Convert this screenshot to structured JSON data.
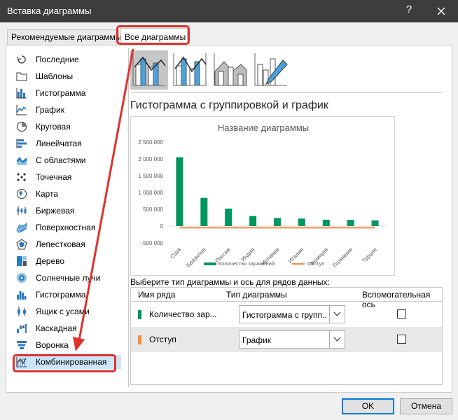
{
  "window": {
    "title": "Вставка диаграммы",
    "help_label": "?"
  },
  "tabs": {
    "recommended": "Рекомендуемые диаграммы",
    "all": "Все диаграммы"
  },
  "sidebar": {
    "items": [
      {
        "label": "Последние",
        "icon": "recent-icon"
      },
      {
        "label": "Шаблоны",
        "icon": "folder-icon"
      },
      {
        "label": "Гистограмма",
        "icon": "column-chart-icon"
      },
      {
        "label": "График",
        "icon": "line-chart-icon"
      },
      {
        "label": "Круговая",
        "icon": "pie-chart-icon"
      },
      {
        "label": "Линейчатая",
        "icon": "bar-chart-icon"
      },
      {
        "label": "С областями",
        "icon": "area-chart-icon"
      },
      {
        "label": "Точечная",
        "icon": "scatter-chart-icon"
      },
      {
        "label": "Карта",
        "icon": "map-chart-icon"
      },
      {
        "label": "Биржевая",
        "icon": "stock-chart-icon"
      },
      {
        "label": "Поверхностная",
        "icon": "surface-chart-icon"
      },
      {
        "label": "Лепестковая",
        "icon": "radar-chart-icon"
      },
      {
        "label": "Дерево",
        "icon": "treemap-chart-icon"
      },
      {
        "label": "Солнечные лучи",
        "icon": "sunburst-chart-icon"
      },
      {
        "label": "Гистограмма",
        "icon": "histogram-chart-icon"
      },
      {
        "label": "Ящик с усами",
        "icon": "box-whisker-chart-icon"
      },
      {
        "label": "Каскадная",
        "icon": "waterfall-chart-icon"
      },
      {
        "label": "Воронка",
        "icon": "funnel-chart-icon"
      },
      {
        "label": "Комбинированная",
        "icon": "combo-chart-icon"
      }
    ]
  },
  "subtype_title": "Гистограмма с группировкой и график",
  "chart_data": {
    "type": "bar",
    "title": "Название диаграммы",
    "categories": [
      "США",
      "Бразилия",
      "Россия",
      "Индия",
      "Испания",
      "Италия",
      "Франция",
      "Германия",
      "Турция"
    ],
    "series": [
      {
        "name": "Количество заражений",
        "values": [
          2050000,
          840000,
          520000,
          300000,
          240000,
          225000,
          190000,
          185000,
          170000
        ],
        "color": "#00965e",
        "type": "bar"
      },
      {
        "name": "Отступ",
        "values": [
          -50000,
          -50000,
          -50000,
          -50000,
          -50000,
          -50000,
          -50000,
          -50000,
          -50000
        ],
        "color": "#f28e3b",
        "type": "line"
      }
    ],
    "y_ticks": [
      "2 500 000",
      "2 000 000",
      "1 500 000",
      "1 000 000",
      "500 000",
      "0",
      "-500 000"
    ],
    "ylim": [
      -500000,
      2500000
    ],
    "grid": false,
    "legend_position": "bottom"
  },
  "series_section": {
    "label": "Выберите тип диаграммы и ось для рядов данных:",
    "headers": {
      "name": "Имя ряда",
      "type": "Тип диаграммы",
      "secondary": "Вспомогательная ось"
    },
    "rows": [
      {
        "name": "Количество зар...",
        "type": "Гистограмма с групп...",
        "color": "#00965e",
        "secondary": false
      },
      {
        "name": "Отступ",
        "type": "График",
        "color": "#f28e3b",
        "secondary": false
      }
    ]
  },
  "buttons": {
    "ok": "OK",
    "cancel": "Отмена"
  },
  "colors": {
    "highlight": "#e0312d",
    "accent": "#0078d7"
  }
}
